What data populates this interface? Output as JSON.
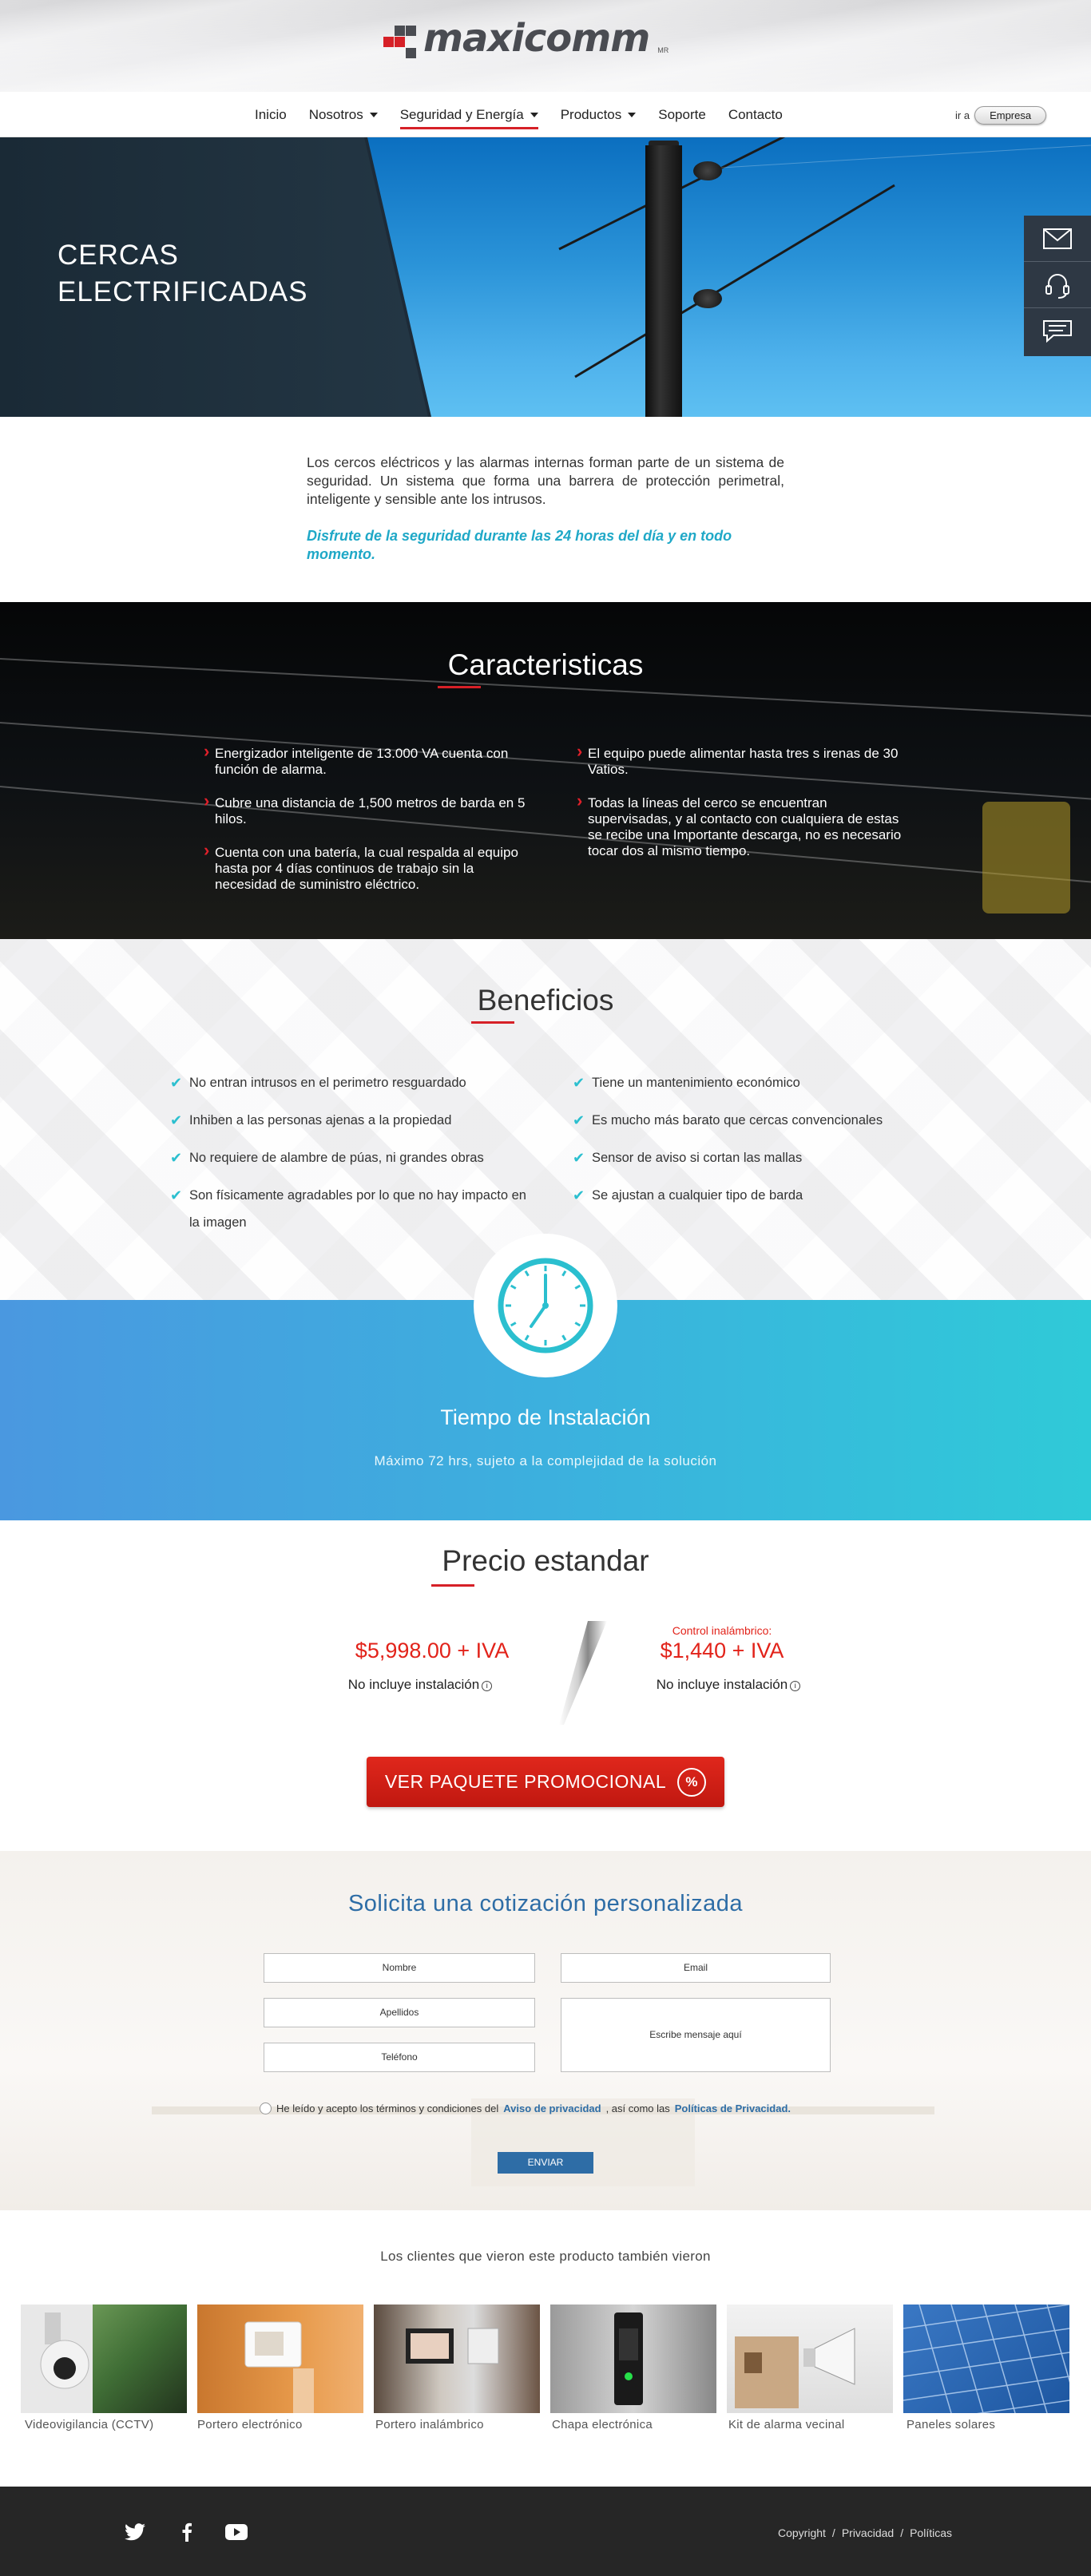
{
  "header": {
    "logo_text": "maxicomm",
    "logo_suffix": "MR",
    "nav": [
      {
        "label": "Inicio"
      },
      {
        "label": "Nosotros"
      },
      {
        "label": "Seguridad y Energía"
      },
      {
        "label": "Productos"
      },
      {
        "label": "Soporte"
      },
      {
        "label": "Contacto"
      }
    ],
    "goto_label": "ir a",
    "empresa_button": "Empresa"
  },
  "hero": {
    "title_line1": "CERCAS",
    "title_line2": "ELECTRIFICADAS",
    "side_icons": [
      "mail-icon",
      "headset-icon",
      "chat-icon"
    ]
  },
  "intro": {
    "text": "Los cercos eléctricos y las alarmas internas forman parte de un sistema de seguridad. Un sistema que forma una barrera de protección perimetral, inteligente y sensible ante los intrusos.",
    "emphasis": "Disfrute de la seguridad durante las 24 horas del día y en todo momento."
  },
  "caracteristicas": {
    "title": "Caracteristicas",
    "left": [
      "Energizador inteligente de 13.000 VA cuenta con función de alarma.",
      "Cubre una distancia de 1,500 metros de barda en 5 hilos.",
      "Cuenta con una batería, la cual respalda al equipo hasta por 4 días continuos de trabajo sin la necesidad de suministro eléctrico."
    ],
    "right": [
      "El equipo puede alimentar hasta tres s irenas de 30 Vatios.",
      "Todas la líneas del cerco se encuentran supervisadas, y al contacto con cualquiera de estas se recibe una Importante descarga, no es necesario tocar dos al mismo tiempo."
    ]
  },
  "beneficios": {
    "title": "Beneficios",
    "left": [
      "No entran intrusos en el perimetro resguardado",
      "Inhiben a las personas ajenas a la propiedad",
      "No requiere de alambre de púas, ni grandes obras",
      "Son físicamente agradables por lo que no hay impacto en la imagen"
    ],
    "right": [
      "Tiene un mantenimiento económico",
      "Es mucho más barato que cercas convencionales",
      "Sensor de aviso si cortan las mallas",
      "Se ajustan a cualquier tipo de barda"
    ]
  },
  "tiempo": {
    "title": "Tiempo de Instalación",
    "subtitle": "Máximo 72 hrs, sujeto a la complejidad de la solución"
  },
  "precio": {
    "title": "Precio estandar",
    "left_price": "$5,998.00 + IVA",
    "left_note": "No incluye instalación",
    "right_label": "Control inalámbrico:",
    "right_price": "$1,440 + IVA",
    "right_note": "No incluye instalación",
    "promo_button": "VER PAQUETE PROMOCIONAL",
    "promo_icon": "%"
  },
  "cotizacion": {
    "title": "Solicita una cotización personalizada",
    "nombre": "Nombre",
    "email": "Email",
    "apellidos": "Apellidos",
    "telefono": "Teléfono",
    "mensaje": "Escribe mensaje aquí",
    "terms_prefix": "He leído y acepto los términos y condiciones del",
    "aviso_link": "Aviso de privacidad",
    "terms_mid": ", así como las",
    "politicas_link": "Políticas de Privacidad.",
    "submit": "ENVIAR"
  },
  "clientes": {
    "title": "Los clientes que vieron este producto también vieron",
    "items": [
      {
        "label": "Videovigilancia (CCTV)"
      },
      {
        "label": "Portero electrónico"
      },
      {
        "label": "Portero inalámbrico"
      },
      {
        "label": "Chapa electrónica"
      },
      {
        "label": "Kit de alarma vecinal"
      },
      {
        "label": "Paneles solares"
      }
    ]
  },
  "footer": {
    "copyright": "Copyright",
    "privacidad": "Privacidad",
    "politicas": "Políticas",
    "sep": "/",
    "social": [
      "twitter-icon",
      "facebook-icon",
      "youtube-icon"
    ]
  },
  "colors": {
    "accent_red": "#d62027",
    "accent_teal": "#2bbfcf",
    "brand_blue": "#2e6da6",
    "dark": "#262626"
  }
}
